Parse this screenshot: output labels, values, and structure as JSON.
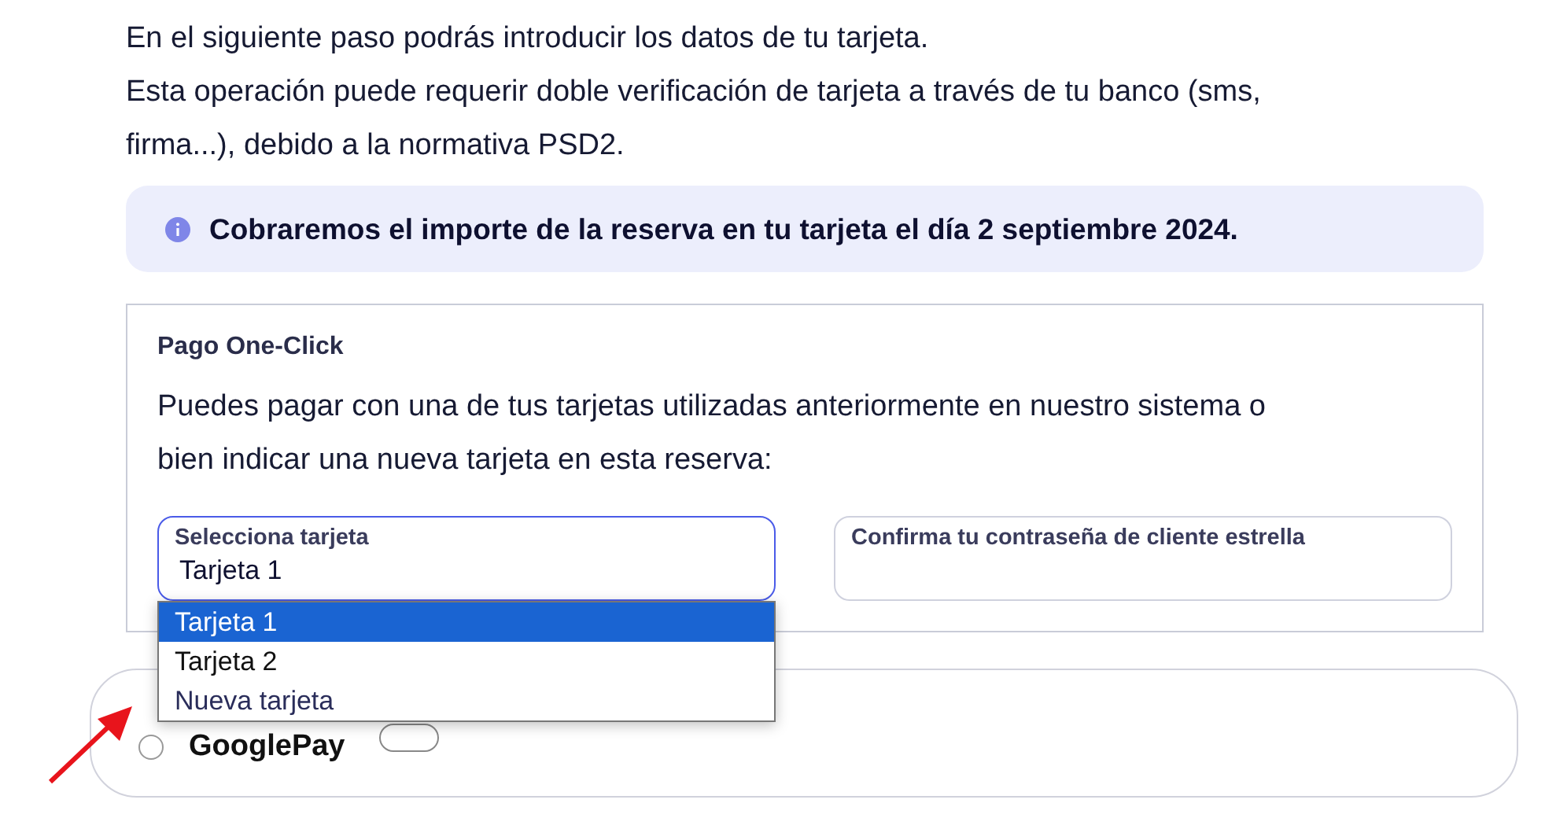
{
  "intro_lines": [
    "En el siguiente paso podrás introducir los datos de tu tarjeta.",
    "Esta operación puede requerir doble verificación de tarjeta a través de tu banco (sms,",
    "firma...), debido a la normativa PSD2."
  ],
  "notice": {
    "text": "Cobraremos el importe de la reserva en tu tarjeta el día 2 septiembre 2024."
  },
  "one_click": {
    "title": "Pago One-Click",
    "description_lines": [
      "Puedes pagar con una de tus tarjetas utilizadas anteriormente en nuestro sistema o",
      "bien indicar una nueva tarjeta en esta reserva:"
    ],
    "card_select": {
      "label": "Selecciona tarjeta",
      "value": "Tarjeta 1",
      "expanded": true,
      "options": [
        {
          "label": "Tarjeta 1",
          "selected": true
        },
        {
          "label": "Tarjeta 2",
          "selected": false
        },
        {
          "label": "Nueva tarjeta",
          "selected": false
        }
      ]
    },
    "password_field": {
      "label": "Confirma tu contraseña de cliente estrella"
    }
  },
  "payment_option": {
    "label": "GooglePay",
    "selected": false
  }
}
